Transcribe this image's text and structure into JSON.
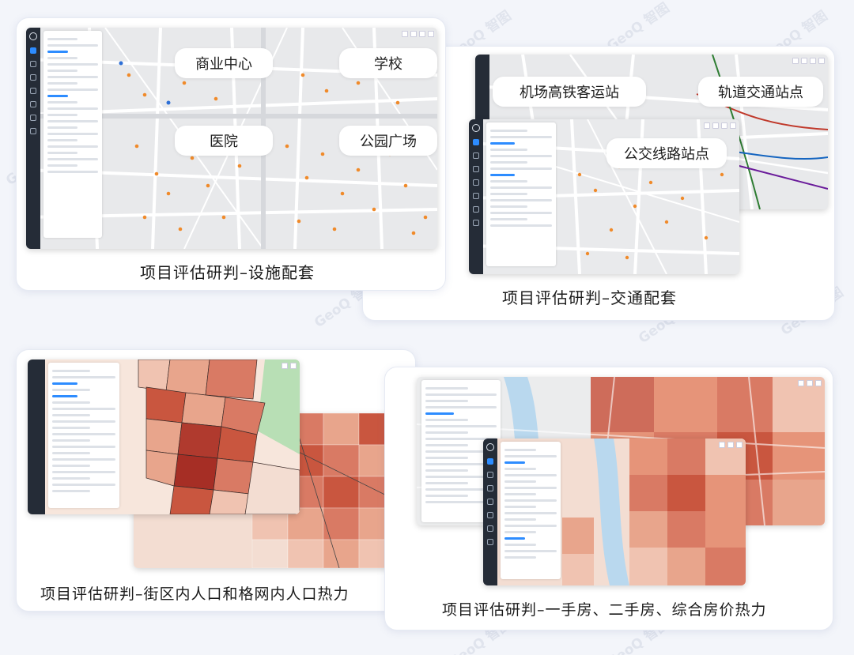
{
  "watermark": "GeoQ 智图",
  "facilities": {
    "caption": "项目评估研判–设施配套",
    "labels": [
      "商业中心",
      "学校",
      "医院",
      "公园广场"
    ]
  },
  "transport": {
    "caption": "项目评估研判–交通配套",
    "labels": [
      "机场高铁客运站",
      "轨道交通站点",
      "公交线路站点"
    ]
  },
  "population": {
    "caption": "项目评估研判–街区内人口和格网内人口热力"
  },
  "housing": {
    "caption": "项目评估研判–一手房、二手房、综合房价热力"
  },
  "colors": {
    "accent": "#2d8cff",
    "poi": "#f08a2a",
    "heat_low": "#f6d7c8",
    "heat_mid": "#e69479",
    "heat_high": "#c8473a",
    "rail": "#252c37"
  }
}
